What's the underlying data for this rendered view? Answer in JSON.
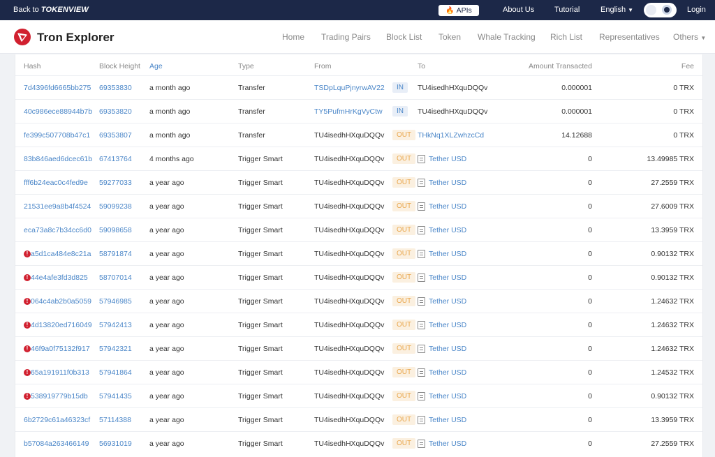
{
  "topbar": {
    "back_prefix": "Back to",
    "back_brand": "TOKENVIEW",
    "apis": "APIs",
    "about": "About Us",
    "tutorial": "Tutorial",
    "language": "English",
    "login": "Login"
  },
  "header": {
    "brand": "Tron Explorer",
    "nav": [
      "Home",
      "Trading Pairs",
      "Block List",
      "Token",
      "Whale Tracking",
      "Rich List",
      "Representatives",
      "Others"
    ]
  },
  "columns": {
    "hash": "Hash",
    "block": "Block Height",
    "age": "Age",
    "type": "Type",
    "from": "From",
    "to": "To",
    "amount": "Amount Transacted",
    "fee": "Fee"
  },
  "colors": {
    "accent": "#4a86c8",
    "in_bg": "#e8eef7",
    "out_fg": "#e9a64b",
    "error": "#d1202f",
    "topbar": "#1c2848"
  },
  "rows": [
    {
      "hash": "7d4396fd6665bb275",
      "block": "69353830",
      "age": "a month ago",
      "type": "Transfer",
      "from": "TSDpLquPjnyrwAV22",
      "from_link": true,
      "dir": "IN",
      "to": "TU4isedhHXquDQQv",
      "to_link": false,
      "token": false,
      "amount": "0.000001",
      "fee": "0 TRX",
      "error": false
    },
    {
      "hash": "40c986ece88944b7b",
      "block": "69353820",
      "age": "a month ago",
      "type": "Transfer",
      "from": "TY5PufmHrKgVyCtw",
      "from_link": true,
      "dir": "IN",
      "to": "TU4isedhHXquDQQv",
      "to_link": false,
      "token": false,
      "amount": "0.000001",
      "fee": "0 TRX",
      "error": false
    },
    {
      "hash": "fe399c507708b47c1",
      "block": "69353807",
      "age": "a month ago",
      "type": "Transfer",
      "from": "TU4isedhHXquDQQv",
      "from_link": false,
      "dir": "OUT",
      "to": "THkNq1XLZwhzcCd",
      "to_link": true,
      "token": false,
      "amount": "14.12688",
      "fee": "0 TRX",
      "error": false
    },
    {
      "hash": "83b846aed6dcec61b",
      "block": "67413764",
      "age": "4 months ago",
      "type": "Trigger Smart",
      "from": "TU4isedhHXquDQQv",
      "from_link": false,
      "dir": "OUT",
      "to": "Tether USD",
      "to_link": true,
      "token": true,
      "amount": "0",
      "fee": "13.49985 TRX",
      "error": false
    },
    {
      "hash": "fff6b24eac0c4fed9e",
      "block": "59277033",
      "age": "a year ago",
      "type": "Trigger Smart",
      "from": "TU4isedhHXquDQQv",
      "from_link": false,
      "dir": "OUT",
      "to": "Tether USD",
      "to_link": true,
      "token": true,
      "amount": "0",
      "fee": "27.2559 TRX",
      "error": false
    },
    {
      "hash": "21531ee9a8b4f4524",
      "block": "59099238",
      "age": "a year ago",
      "type": "Trigger Smart",
      "from": "TU4isedhHXquDQQv",
      "from_link": false,
      "dir": "OUT",
      "to": "Tether USD",
      "to_link": true,
      "token": true,
      "amount": "0",
      "fee": "27.6009 TRX",
      "error": false
    },
    {
      "hash": "eca73a8c7b34cc6d0",
      "block": "59098658",
      "age": "a year ago",
      "type": "Trigger Smart",
      "from": "TU4isedhHXquDQQv",
      "from_link": false,
      "dir": "OUT",
      "to": "Tether USD",
      "to_link": true,
      "token": true,
      "amount": "0",
      "fee": "13.3959 TRX",
      "error": false
    },
    {
      "hash": "a5d1ca484e8c21a",
      "block": "58791874",
      "age": "a year ago",
      "type": "Trigger Smart",
      "from": "TU4isedhHXquDQQv",
      "from_link": false,
      "dir": "OUT",
      "to": "Tether USD",
      "to_link": true,
      "token": true,
      "amount": "0",
      "fee": "0.90132 TRX",
      "error": true
    },
    {
      "hash": "44e4afe3fd3d825",
      "block": "58707014",
      "age": "a year ago",
      "type": "Trigger Smart",
      "from": "TU4isedhHXquDQQv",
      "from_link": false,
      "dir": "OUT",
      "to": "Tether USD",
      "to_link": true,
      "token": true,
      "amount": "0",
      "fee": "0.90132 TRX",
      "error": true
    },
    {
      "hash": "064c4ab2b0a5059",
      "block": "57946985",
      "age": "a year ago",
      "type": "Trigger Smart",
      "from": "TU4isedhHXquDQQv",
      "from_link": false,
      "dir": "OUT",
      "to": "Tether USD",
      "to_link": true,
      "token": true,
      "amount": "0",
      "fee": "1.24632 TRX",
      "error": true
    },
    {
      "hash": "4d13820ed716049",
      "block": "57942413",
      "age": "a year ago",
      "type": "Trigger Smart",
      "from": "TU4isedhHXquDQQv",
      "from_link": false,
      "dir": "OUT",
      "to": "Tether USD",
      "to_link": true,
      "token": true,
      "amount": "0",
      "fee": "1.24632 TRX",
      "error": true
    },
    {
      "hash": "46f9a0f75132f917",
      "block": "57942321",
      "age": "a year ago",
      "type": "Trigger Smart",
      "from": "TU4isedhHXquDQQv",
      "from_link": false,
      "dir": "OUT",
      "to": "Tether USD",
      "to_link": true,
      "token": true,
      "amount": "0",
      "fee": "1.24632 TRX",
      "error": true
    },
    {
      "hash": "65a191911f0b313",
      "block": "57941864",
      "age": "a year ago",
      "type": "Trigger Smart",
      "from": "TU4isedhHXquDQQv",
      "from_link": false,
      "dir": "OUT",
      "to": "Tether USD",
      "to_link": true,
      "token": true,
      "amount": "0",
      "fee": "1.24532 TRX",
      "error": true
    },
    {
      "hash": "538919779b15db",
      "block": "57941435",
      "age": "a year ago",
      "type": "Trigger Smart",
      "from": "TU4isedhHXquDQQv",
      "from_link": false,
      "dir": "OUT",
      "to": "Tether USD",
      "to_link": true,
      "token": true,
      "amount": "0",
      "fee": "0.90132 TRX",
      "error": true
    },
    {
      "hash": "6b2729c61a46323cf",
      "block": "57114388",
      "age": "a year ago",
      "type": "Trigger Smart",
      "from": "TU4isedhHXquDQQv",
      "from_link": false,
      "dir": "OUT",
      "to": "Tether USD",
      "to_link": true,
      "token": true,
      "amount": "0",
      "fee": "13.3959 TRX",
      "error": false
    },
    {
      "hash": "b57084a263466149",
      "block": "56931019",
      "age": "a year ago",
      "type": "Trigger Smart",
      "from": "TU4isedhHXquDQQv",
      "from_link": false,
      "dir": "OUT",
      "to": "Tether USD",
      "to_link": true,
      "token": true,
      "amount": "0",
      "fee": "27.2559 TRX",
      "error": false
    }
  ]
}
